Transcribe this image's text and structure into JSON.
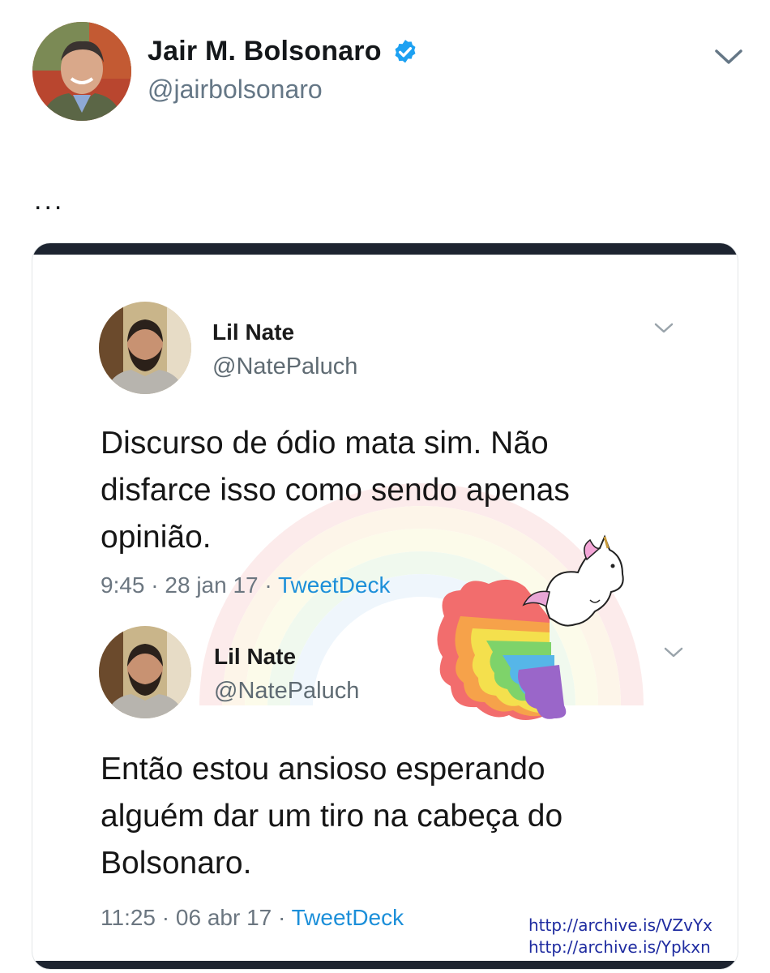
{
  "header": {
    "display_name": "Jair M. Bolsonaro",
    "handle": "@jairbolsonaro",
    "tweet_text": "...",
    "verified": true
  },
  "tweets": [
    {
      "name": "Lil Nate",
      "handle": "@NatePaluch",
      "text_lines": [
        "Discurso de ódio mata sim. Não",
        "disfarce isso como sendo apenas",
        "opinião."
      ],
      "time": "9:45",
      "date": "28 jan 17",
      "source": "TweetDeck"
    },
    {
      "name": "Lil Nate",
      "handle": "@NatePaluch",
      "text_lines": [
        "Então estou ansioso esperando",
        "alguém dar um tiro na cabeça do",
        "Bolsonaro."
      ],
      "time": "11:25",
      "date": "06 abr 17",
      "source": "TweetDeck"
    }
  ],
  "archive_links": [
    "http://archive.is/VZvYx",
    "http://archive.is/Ypkxn"
  ],
  "colors": {
    "verified": "#1da1f2",
    "link": "#1c8fd9",
    "archive": "#1e2ba0",
    "muted": "#657786"
  }
}
